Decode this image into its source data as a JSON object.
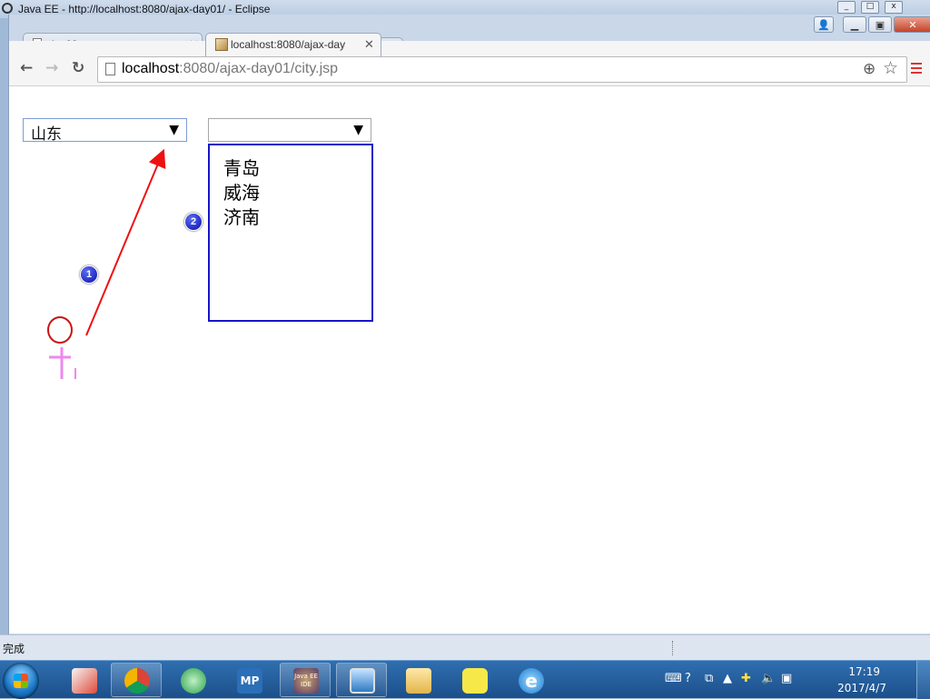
{
  "eclipse": {
    "title": "Java EE - http://localhost:8080/ajax-day01/ - Eclipse"
  },
  "browser": {
    "tabs": [
      {
        "label": "day09"
      },
      {
        "label": "localhost:8080/ajax-day"
      }
    ],
    "url": {
      "host": "localhost",
      "rest": ":8080/ajax-day01/city.jsp"
    },
    "icons": {
      "back": "←",
      "forward": "→",
      "reload": "↻",
      "zoom": "⊕",
      "star": "☆",
      "close": "✕"
    }
  },
  "page": {
    "province_select": {
      "value": "山东",
      "arrow": "▼"
    },
    "city_select": {
      "value": "",
      "arrow": "▼"
    },
    "city_options": [
      "青岛",
      "威海",
      "济南"
    ],
    "annotations": [
      {
        "label": "1"
      },
      {
        "label": "2"
      }
    ],
    "colors": {
      "arrow": "#ee1111",
      "list_border": "#1616c8",
      "marker": "#ee88ee"
    }
  },
  "status": {
    "text": "完成"
  },
  "taskbar": {
    "apps": [
      "notes",
      "chrome",
      "vine",
      "MP",
      "Java EE IDE",
      "image-viewer",
      "file-explorer",
      "smile",
      "ie"
    ],
    "clock": {
      "time": "17:19",
      "date": "2017/4/7"
    }
  }
}
